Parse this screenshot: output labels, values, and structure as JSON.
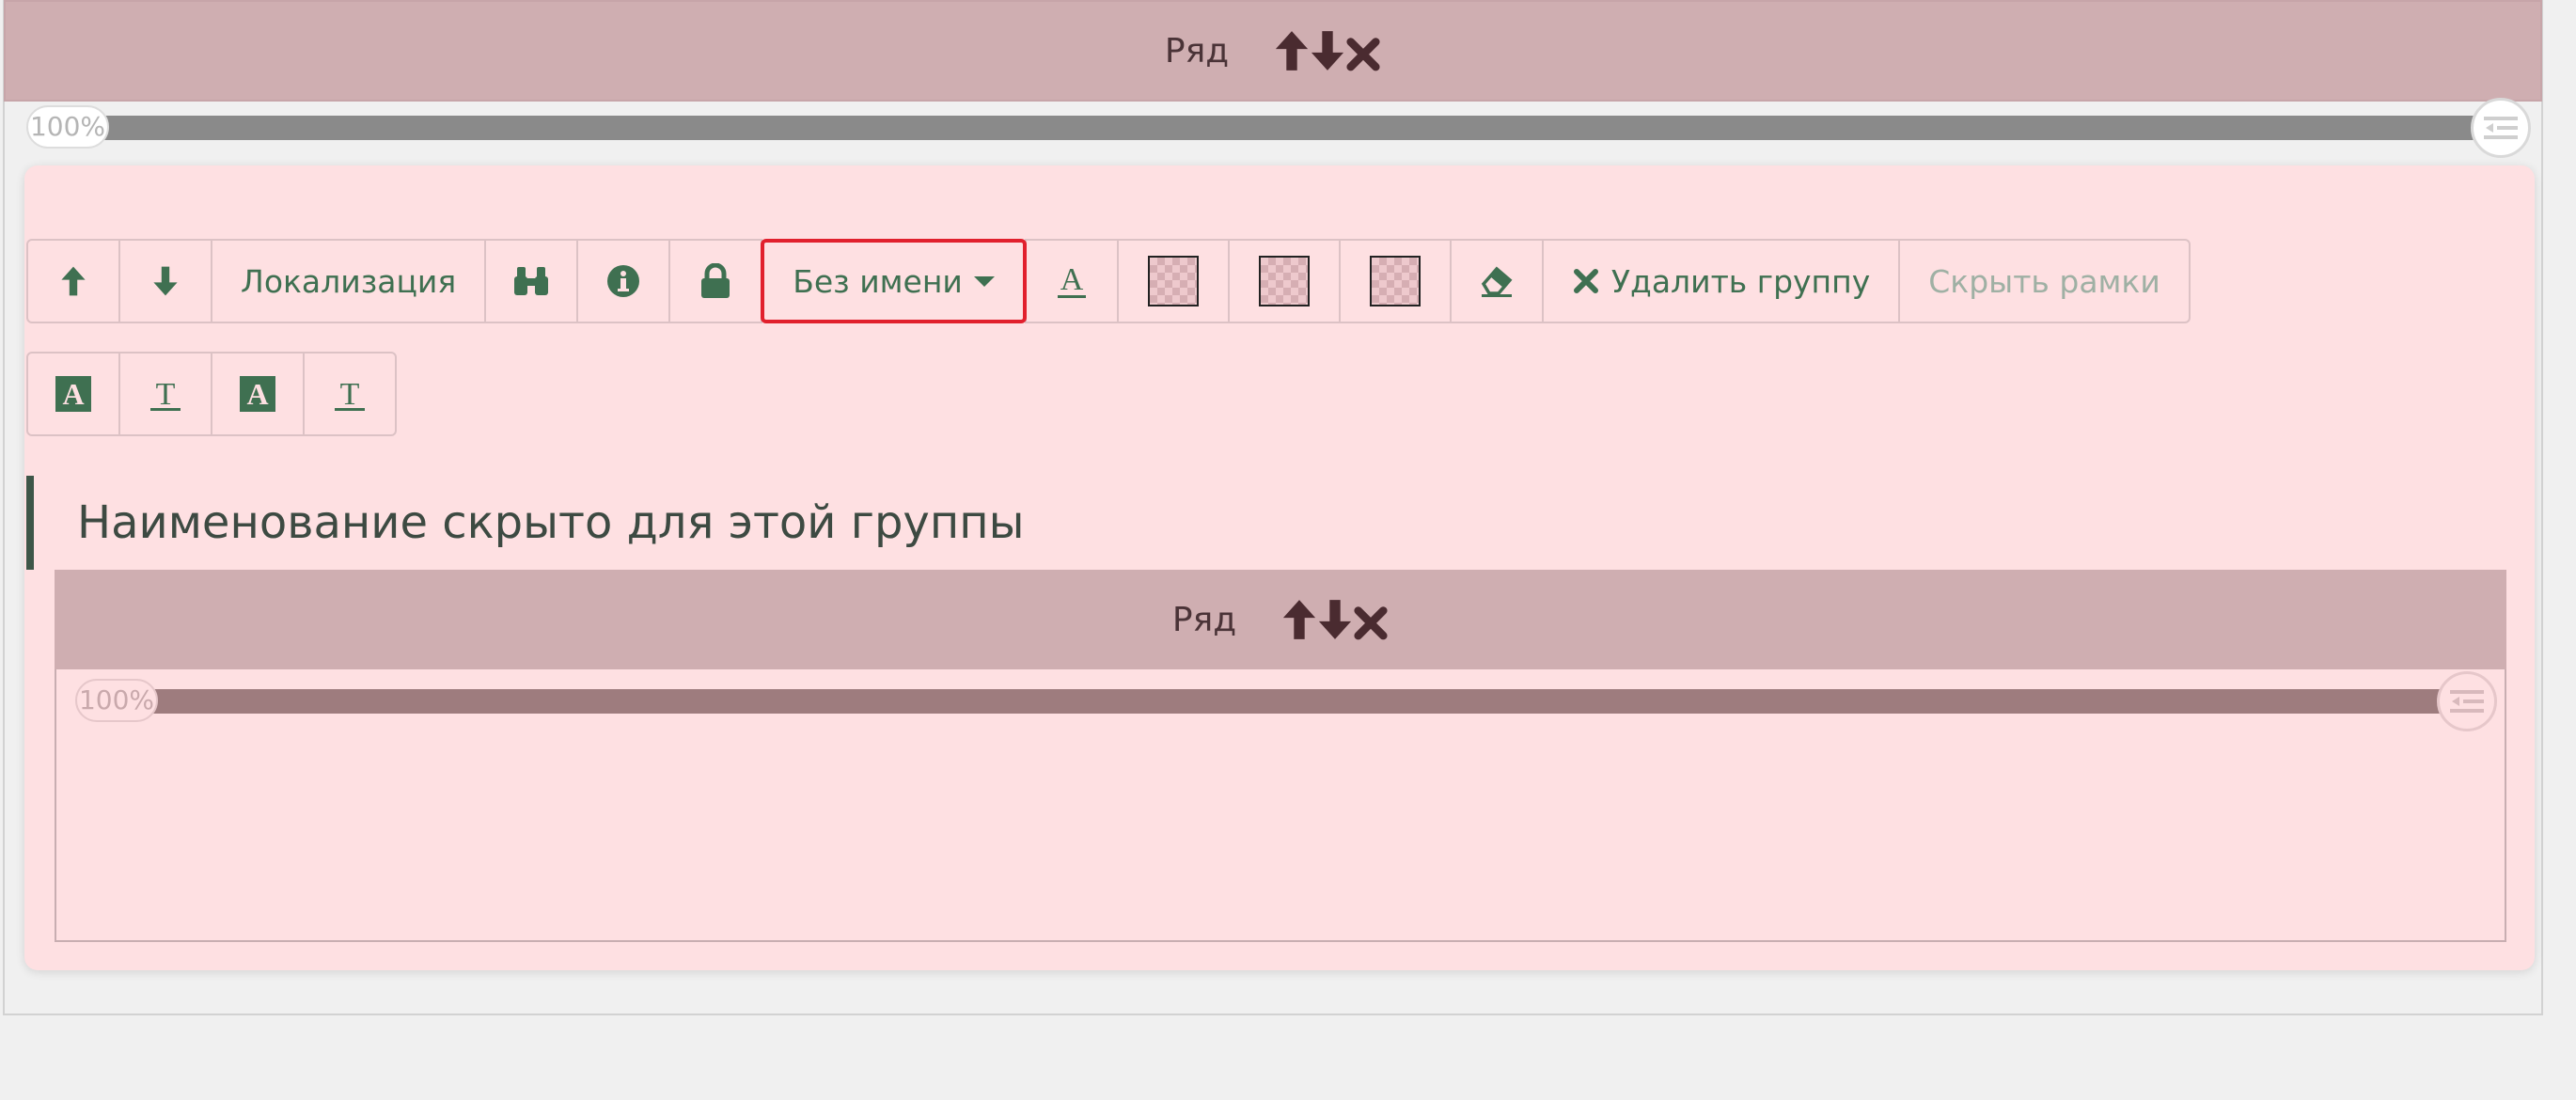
{
  "top_row": {
    "label": "Ряд",
    "slider_value": "100%",
    "slider_percent": 100
  },
  "toolbar": {
    "localization_label": "Локализация",
    "name_dropdown_label": "Без имени",
    "delete_group_label": "Удалить группу",
    "hide_frames_label": "Скрыть рамки",
    "icons": [
      "arrow-up-icon",
      "arrow-down-icon",
      "binoculars-icon",
      "info-icon",
      "lock-icon",
      "text-color-icon",
      "checker-swatch-icon",
      "eraser-icon",
      "close-icon"
    ]
  },
  "group": {
    "title": "Наименование скрыто для этой группы"
  },
  "inner_row": {
    "label": "Ряд",
    "slider_value": "100%",
    "slider_percent": 100
  },
  "colors": {
    "row_bar": "#cfaeb1",
    "group_bg": "#fee0e2",
    "accent_green": "#3f7051",
    "selected_border": "#e1202d",
    "row_icons": "#4a2b30"
  }
}
